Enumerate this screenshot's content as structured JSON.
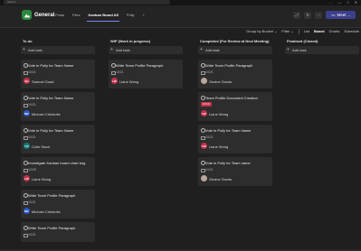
{
  "top": {
    "search_placeholder": "Search",
    "ctrls": [
      "…",
      "—",
      "□",
      "✕"
    ]
  },
  "header": {
    "channel": "General",
    "tabs": [
      "Posts",
      "Files",
      "Kanban Board A5",
      "+",
      "Polly",
      "+"
    ],
    "active_tab_index": 2,
    "meet_label": "Meet"
  },
  "toolbar": {
    "group_by": "Group by Bucket ⌄",
    "filter": "Filter ⌄",
    "list": "List",
    "board": "Board",
    "charts": "Charts",
    "schedule": "Schedule"
  },
  "columns": [
    {
      "title": "To do",
      "add_label": "Add task",
      "cards": [
        {
          "title": "Vote in Polly for Team Name",
          "date": "10/21",
          "initials": "SG",
          "color": "#c4314b",
          "assignee": "Samuel Goad"
        },
        {
          "title": "Vote in Polly for Team Name",
          "date": "10/21",
          "initials": "MC",
          "color": "#2d59c7",
          "assignee": "Michael Christofis"
        },
        {
          "title": "Vote in Polly for Team Name",
          "date": "10/21",
          "initials": "CS",
          "color": "#0e7a7a",
          "assignee": "Colin Stock"
        },
        {
          "title": "Investigate Kanban board chart bug",
          "date": "10/28",
          "initials": "LW",
          "color": "#c4314b",
          "assignee": "Liane Wong"
        },
        {
          "title": "Write Team Profile Paragraph",
          "date": "10/21",
          "initials": "MC",
          "color": "#2d59c7",
          "assignee": "Michael Christofis"
        },
        {
          "title": "Write Team Profile Paragraph",
          "date": "10/21",
          "initials": "",
          "color": "",
          "assignee": ""
        }
      ]
    },
    {
      "title": "WIP (Work in progress)",
      "add_label": "Add task",
      "cards": [
        {
          "title": "Write Team Profile Paragraph",
          "date": "10/21",
          "initials": "LW",
          "color": "#c4314b",
          "assignee": "Liane Wong"
        }
      ]
    },
    {
      "title": "Completed (For Review at Next Meeting)",
      "add_label": "Add task",
      "cards": [
        {
          "title": "Write Team Profile Paragraph",
          "date": "10/21",
          "initials": "",
          "color": "photo",
          "assignee": "Gesine Sands"
        },
        {
          "title": "Team Profile Document Creation",
          "date": "10/19",
          "badge": true,
          "initials": "LW",
          "color": "#c4314b",
          "assignee": "Liane Wong"
        },
        {
          "title": "Vote in Polly for Team Name",
          "date": "10/21",
          "initials": "LW",
          "color": "#c4314b",
          "assignee": "Liane Wong"
        },
        {
          "title": "Vote in Polly for Team name",
          "date": "10/21",
          "initials": "",
          "color": "photo",
          "assignee": "Gesine Sands"
        }
      ]
    },
    {
      "title": "Finalised (Closed)",
      "add_label": "Add task",
      "cards": []
    }
  ]
}
